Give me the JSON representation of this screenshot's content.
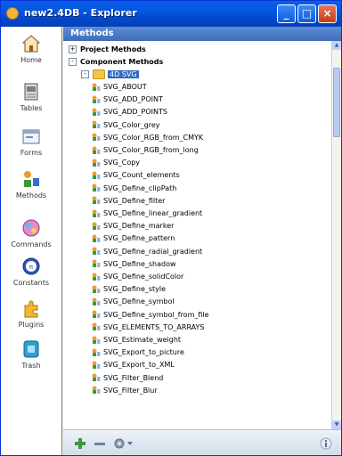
{
  "window": {
    "title": "new2.4DB - Explorer"
  },
  "sidebar": {
    "items": [
      {
        "label": "Home",
        "icon": "house-icon"
      },
      {
        "label": "Tables",
        "icon": "table-icon"
      },
      {
        "label": "Forms",
        "icon": "form-icon"
      },
      {
        "label": "Methods",
        "icon": "methods-icon"
      },
      {
        "label": "Commands",
        "icon": "commands-icon"
      },
      {
        "label": "Constants",
        "icon": "constants-icon"
      },
      {
        "label": "Plugins",
        "icon": "plugins-icon"
      },
      {
        "label": "Trash",
        "icon": "trash-icon"
      }
    ]
  },
  "main": {
    "header": "Methods",
    "groups": [
      {
        "label": "Project Methods",
        "expander": "+"
      },
      {
        "label": "Component Methods",
        "expander": "-"
      }
    ],
    "folder": {
      "label": "4D SVG",
      "expander": "-"
    },
    "methods": [
      "SVG_ABOUT",
      "SVG_ADD_POINT",
      "SVG_ADD_POINTS",
      "SVG_Color_grey",
      "SVG_Color_RGB_from_CMYK",
      "SVG_Color_RGB_from_long",
      "SVG_Copy",
      "SVG_Count_elements",
      "SVG_Define_clipPath",
      "SVG_Define_filter",
      "SVG_Define_linear_gradient",
      "SVG_Define_marker",
      "SVG_Define_pattern",
      "SVG_Define_radial_gradient",
      "SVG_Define_shadow",
      "SVG_Define_solidColor",
      "SVG_Define_style",
      "SVG_Define_symbol",
      "SVG_Define_symbol_from_file",
      "SVG_ELEMENTS_TO_ARRAYS",
      "SVG_Estimate_weight",
      "SVG_Export_to_picture",
      "SVG_Export_to_XML",
      "SVG_Filter_Blend",
      "SVG_Filter_Blur"
    ],
    "colors": {
      "accent": "#3F6BB8",
      "title_bar": "#0454E0"
    }
  },
  "bottom": {
    "add_icon": "plus-icon",
    "remove_icon": "minus-icon",
    "options_icon": "gear-icon",
    "info_icon": "info-icon"
  }
}
